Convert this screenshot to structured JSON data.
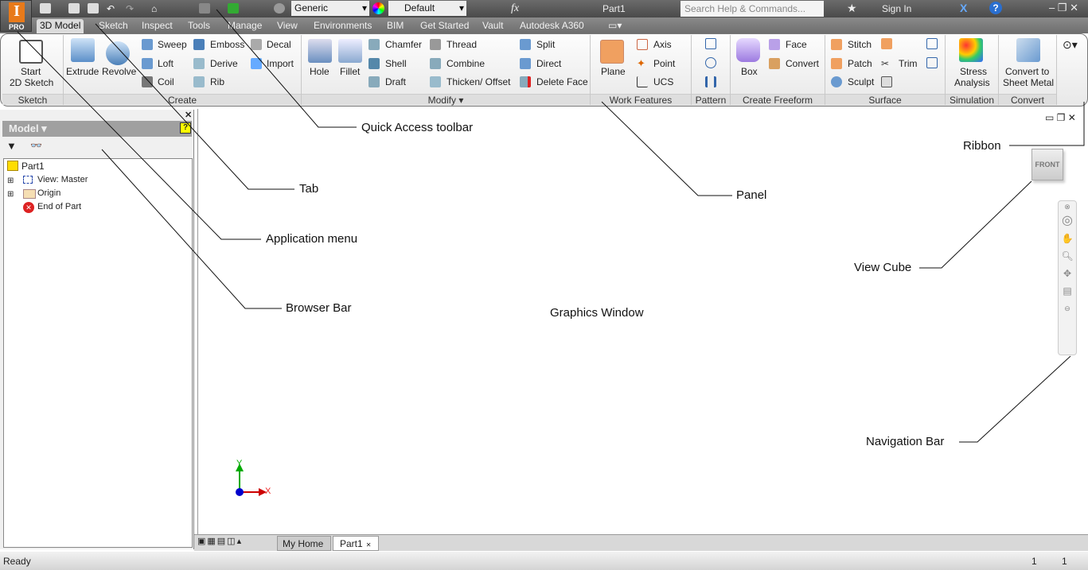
{
  "title_bar": {
    "material": "Generic",
    "appearance": "Default",
    "fx": "fx",
    "document": "Part1",
    "search_placeholder": "Search Help & Commands...",
    "sign_in": "Sign In",
    "app_badge": "PRO"
  },
  "tabs": [
    "3D Model",
    "Sketch",
    "Inspect",
    "Tools",
    "Manage",
    "View",
    "Environments",
    "BIM",
    "Get Started",
    "Vault",
    "Autodesk A360"
  ],
  "ribbon": {
    "sketch": {
      "start": "Start",
      "start2": "2D Sketch",
      "panel": "Sketch"
    },
    "create": {
      "extrude": "Extrude",
      "revolve": "Revolve",
      "sweep": "Sweep",
      "loft": "Loft",
      "coil": "Coil",
      "emboss": "Emboss",
      "derive": "Derive",
      "rib": "Rib",
      "decal": "Decal",
      "import": "Import",
      "panel": "Create"
    },
    "modify": {
      "hole": "Hole",
      "fillet": "Fillet",
      "chamfer": "Chamfer",
      "shell": "Shell",
      "draft": "Draft",
      "thread": "Thread",
      "combine": "Combine",
      "thicken": "Thicken/ Offset",
      "split": "Split",
      "direct": "Direct",
      "delete_face": "Delete Face",
      "panel": "Modify ▾"
    },
    "work": {
      "plane": "Plane",
      "axis": "Axis",
      "point": "Point",
      "ucs": "UCS",
      "panel": "Work Features"
    },
    "pattern": {
      "panel": "Pattern"
    },
    "freeform": {
      "box": "Box",
      "face": "Face",
      "convert": "Convert",
      "panel": "Create Freeform"
    },
    "surface": {
      "stitch": "Stitch",
      "patch": "Patch",
      "sculpt": "Sculpt",
      "trim": "Trim",
      "panel": "Surface"
    },
    "simulation": {
      "stress": "Stress",
      "stress2": "Analysis",
      "panel": "Simulation"
    },
    "convert": {
      "c1": "Convert to",
      "c2": "Sheet Metal",
      "panel": "Convert"
    }
  },
  "browser": {
    "title": "Model ▾",
    "tree": [
      "Part1",
      "View: Master",
      "Origin",
      "End of Part"
    ]
  },
  "graphics": {
    "viewcube": "FRONT",
    "axis_x": "X",
    "axis_y": "Y"
  },
  "doc_tabs": [
    "My Home",
    "Part1"
  ],
  "status": {
    "text": "Ready",
    "n1": "1",
    "n2": "1"
  },
  "annotations": {
    "quick_access": "Quick Access toolbar",
    "ribbon": "Ribbon",
    "tab": "Tab",
    "panel": "Panel",
    "app_menu": "Application menu",
    "view_cube": "View Cube",
    "browser_bar": "Browser Bar",
    "graphics_window": "Graphics Window",
    "nav_bar": "Navigation Bar"
  }
}
